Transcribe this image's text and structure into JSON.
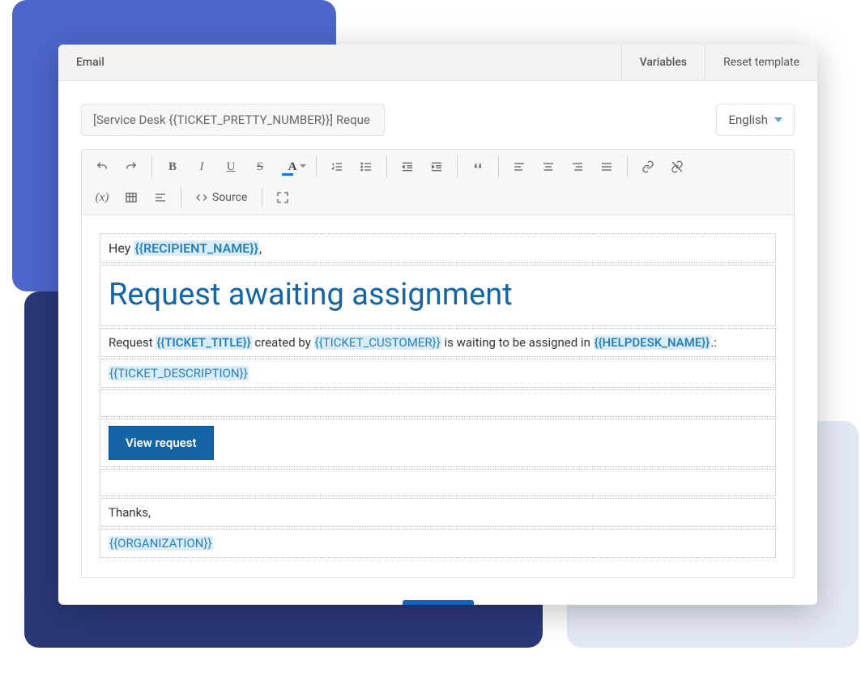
{
  "header": {
    "tab_email": "Email",
    "tab_variables": "Variables",
    "tab_reset": "Reset template"
  },
  "subject": {
    "value": "[Service Desk {{TICKET_PRETTY_NUMBER}}] Reque"
  },
  "language": {
    "selected": "English"
  },
  "toolbar": {
    "source_label": "Source"
  },
  "content": {
    "greeting_prefix": "Hey ",
    "recipient_var": "{{RECIPIENT_NAME}}",
    "greeting_suffix": ",",
    "title": "Request awaiting assignment",
    "line_prefix": "Request ",
    "ticket_title_var": "{{TICKET_TITLE}}",
    "line_mid1": " created by ",
    "ticket_customer_var": "{{TICKET_CUSTOMER}}",
    "line_mid2": " is waiting to be assigned in ",
    "helpdesk_var": "{{HELPDESK_NAME}}",
    "line_suffix": ".:",
    "description_var": "{{TICKET_DESCRIPTION}}",
    "view_button": "View request",
    "thanks": "Thanks,",
    "org_var": "{{ORGANIZATION}}"
  }
}
